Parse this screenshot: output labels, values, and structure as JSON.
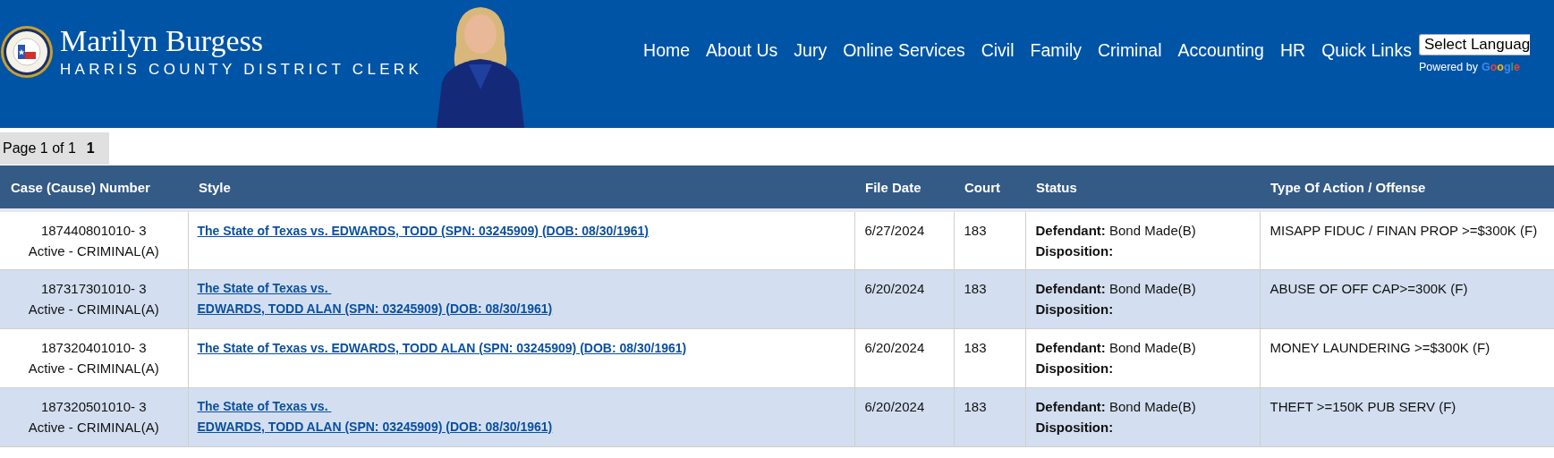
{
  "header": {
    "name": "Marilyn Burgess",
    "subtitle": "HARRIS COUNTY DISTRICT CLERK",
    "nav": [
      "Home",
      "About Us",
      "Jury",
      "Online Services",
      "Civil",
      "Family",
      "Criminal",
      "Accounting",
      "HR",
      "Quick Links"
    ],
    "language_select": "Select Languag",
    "powered_by": "Powered by",
    "google": "Google"
  },
  "pager": {
    "label": "Page 1 of 1",
    "pages": [
      {
        "label": "1",
        "selected": true
      }
    ]
  },
  "table": {
    "columns": [
      "Case (Cause) Number",
      "Style",
      "File Date",
      "Court",
      "Status",
      "Type Of Action / Offense"
    ],
    "rows": [
      {
        "case_number": "187440801010- 3",
        "case_status": "Active - CRIMINAL(A)",
        "style": [
          "The State of Texas vs. EDWARDS, TODD (SPN: 03245909) (DOB: 08/30/1961)"
        ],
        "file_date": "6/27/2024",
        "court": "183",
        "defendant_label": "Defendant:",
        "defendant": "Bond Made(B)",
        "disposition_label": "Disposition:",
        "offense": "MISAPP FIDUC / FINAN PROP >=$300K (F)"
      },
      {
        "case_number": "187317301010- 3",
        "case_status": "Active - CRIMINAL(A)",
        "style": [
          "The State of Texas vs. ",
          "EDWARDS, TODD ALAN (SPN: 03245909) (DOB: 08/30/1961)"
        ],
        "file_date": "6/20/2024",
        "court": "183",
        "defendant_label": "Defendant:",
        "defendant": "Bond Made(B)",
        "disposition_label": "Disposition:",
        "offense": "ABUSE OF OFF CAP>=300K (F)"
      },
      {
        "case_number": "187320401010- 3",
        "case_status": "Active - CRIMINAL(A)",
        "style": [
          "The State of Texas vs. EDWARDS, TODD ALAN (SPN: 03245909) (DOB: 08/30/1961)"
        ],
        "file_date": "6/20/2024",
        "court": "183",
        "defendant_label": "Defendant:",
        "defendant": "Bond Made(B)",
        "disposition_label": "Disposition:",
        "offense": "MONEY LAUNDERING >=$300K (F)"
      },
      {
        "case_number": "187320501010- 3",
        "case_status": "Active - CRIMINAL(A)",
        "style": [
          "The State of Texas vs. ",
          "EDWARDS, TODD ALAN (SPN: 03245909) (DOB: 08/30/1961)"
        ],
        "file_date": "6/20/2024",
        "court": "183",
        "defendant_label": "Defendant:",
        "defendant": "Bond Made(B)",
        "disposition_label": "Disposition:",
        "offense": "THEFT >=150K PUB SERV (F)"
      }
    ]
  }
}
